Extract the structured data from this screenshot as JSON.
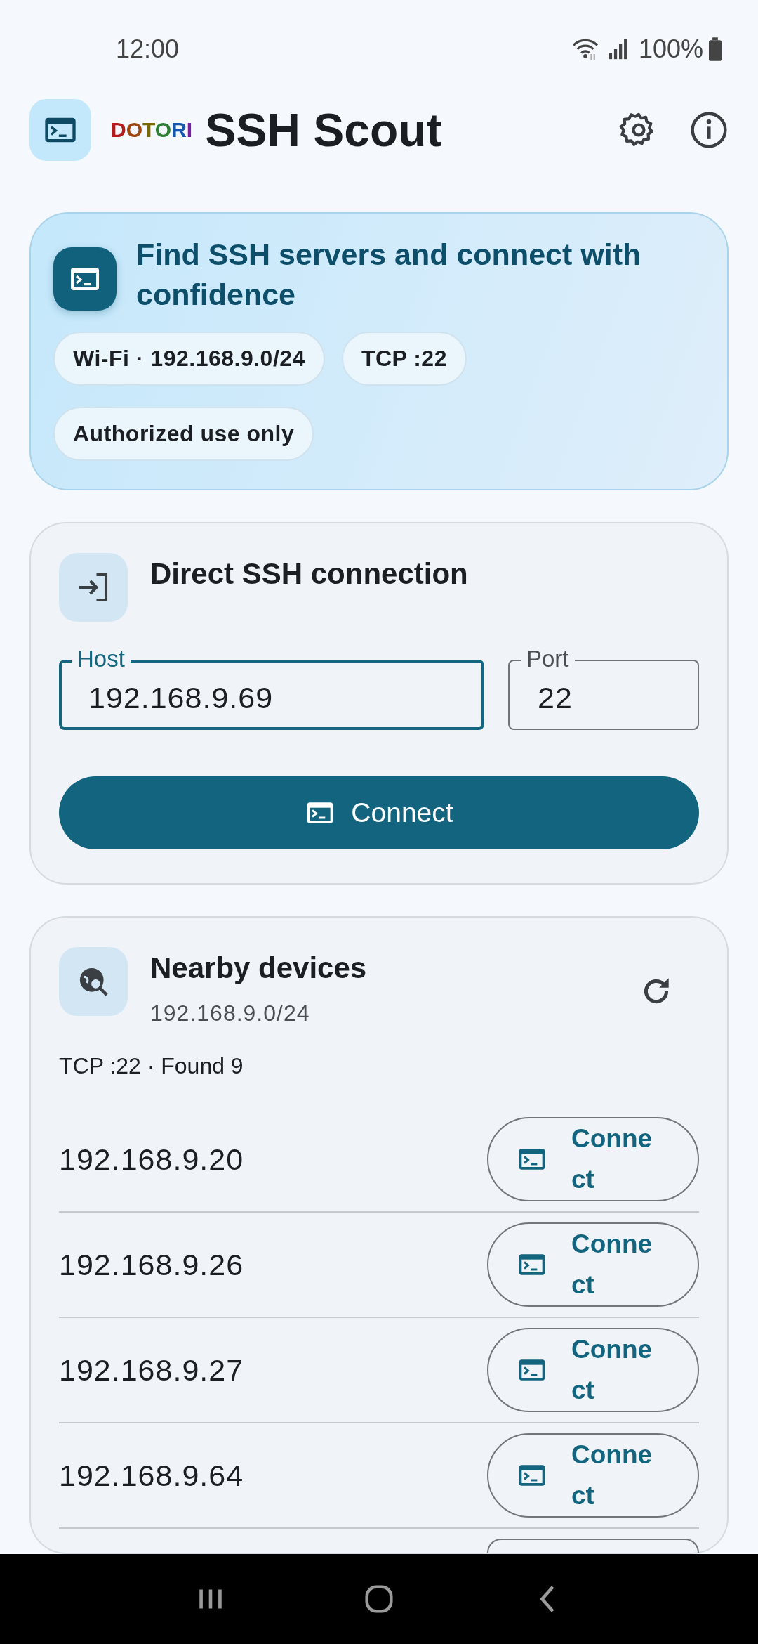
{
  "status_bar": {
    "time": "12:00",
    "battery": "100%"
  },
  "app_bar": {
    "brand": {
      "text": "DOTORI",
      "letters": [
        {
          "color": "#b71c1c"
        },
        {
          "color": "#a0470f"
        },
        {
          "color": "#7a6a00"
        },
        {
          "color": "#2e7d32"
        },
        {
          "color": "#1558b0"
        },
        {
          "color": "#7b1fa2"
        }
      ]
    },
    "title": "SSH Scout"
  },
  "hero": {
    "title": "Find SSH servers and connect with confidence",
    "chips": [
      "Wi-Fi · 192.168.9.0/24",
      "TCP :22",
      "Authorized use only"
    ]
  },
  "direct": {
    "title": "Direct SSH connection",
    "fields": [
      {
        "label": "Host",
        "value": "192.168.9.69",
        "focused": true
      },
      {
        "label": "Port",
        "value": "22",
        "focused": false
      }
    ],
    "button": "Connect"
  },
  "nearby": {
    "title": "Nearby devices",
    "subtitle": "192.168.9.0/24",
    "summary": "TCP :22 · Found 9",
    "devices": [
      {
        "ip": "192.168.9.20",
        "action": "Connect"
      },
      {
        "ip": "192.168.9.26",
        "action": "Connect"
      },
      {
        "ip": "192.168.9.27",
        "action": "Connect"
      },
      {
        "ip": "192.168.9.64",
        "action": "Connect"
      }
    ],
    "more_below": true
  }
}
